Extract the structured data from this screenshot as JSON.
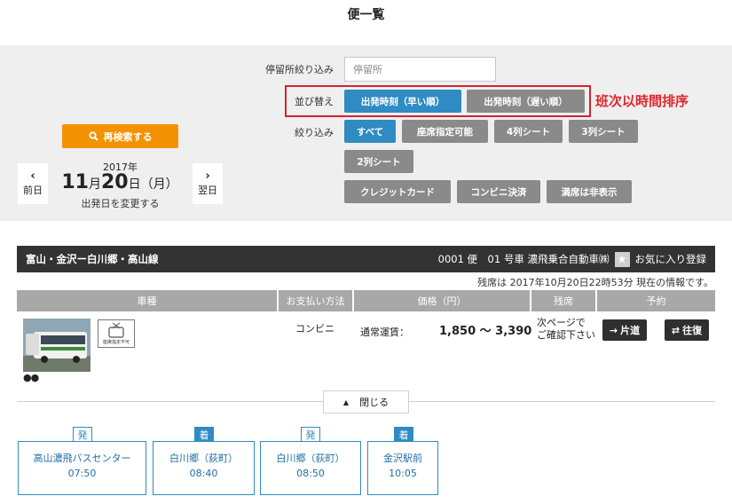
{
  "page_title": "便一覧",
  "filters": {
    "stop_label": "停留所絞り込み",
    "stop_placeholder": "停留所",
    "sort_label": "並び替え",
    "sort_early": "出発時刻（早い順）",
    "sort_late": "出発時刻（遅い順）",
    "narrow_label": "絞り込み",
    "chips": [
      "すべて",
      "座席指定可能",
      "4列シート",
      "3列シート",
      "2列シート",
      "クレジットカード",
      "コンビニ決済",
      "満席は非表示"
    ],
    "annotation": "班次以時間排序"
  },
  "research_button": "再検索する",
  "date": {
    "prev": "前日",
    "next": "翌日",
    "year": "2017年",
    "month": "11",
    "month_unit": "月",
    "day": "20",
    "day_unit": "日",
    "weekday": "（月）",
    "change": "出発日を変更する"
  },
  "route": {
    "name": "富山・金沢ー白川郷・高山線",
    "bus_info": "0001 便　01 号車 濃飛乗合自動車㈱",
    "favorite": "お気に入り登録",
    "seat_info": "残席は 2017年10月20日22時53分 現在の情報です。"
  },
  "table": {
    "headers": [
      "車種",
      "お支払い方法",
      "価格（円）",
      "残席",
      "予約"
    ],
    "seat_icon_caption": "座席指定不可",
    "bus_dots": "●●",
    "payment": "コンビニ",
    "fare_label": "通常運賃：",
    "price": "1,850 〜 3,390",
    "remaining_line1": "次ページで",
    "remaining_line2": "ご確認下さい",
    "one_way": "片道",
    "round_trip": "往復"
  },
  "close_button": "閉じる",
  "stops": [
    {
      "badge": "発",
      "type": "dep",
      "name": "高山濃飛バスセンター",
      "time": "07:50"
    },
    {
      "badge": "着",
      "type": "arr",
      "name": "白川郷（荻町）",
      "time": "08:40"
    },
    {
      "badge": "発",
      "type": "dep",
      "name": "白川郷（荻町）",
      "time": "08:50"
    },
    {
      "badge": "着",
      "type": "arr",
      "name": "金沢駅前",
      "time": "10:05"
    }
  ],
  "colors": {
    "accent_blue": "#2f8bc2",
    "orange": "#f39200",
    "highlight_red": "#d4232f",
    "dark_bar": "#333333"
  }
}
